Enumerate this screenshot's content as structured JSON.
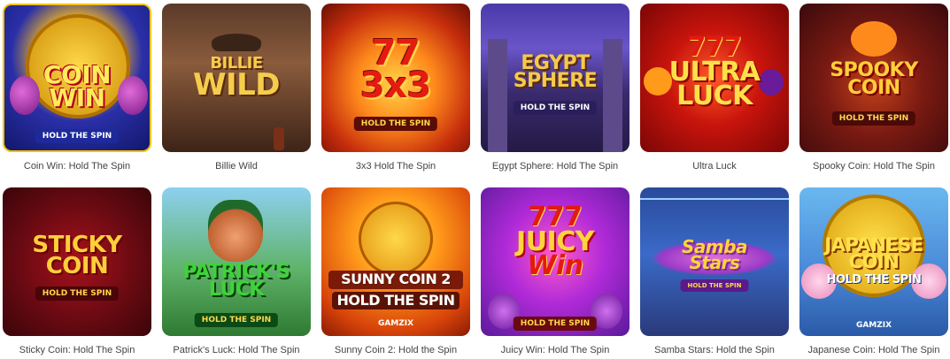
{
  "games": [
    {
      "title": "Coin Win: Hold The Spin",
      "logo_lines": [
        "COIN",
        "WIN"
      ],
      "badge": "HOLD THE SPIN",
      "selected": true
    },
    {
      "title": "Billie Wild",
      "logo_lines": [
        "BILLIE",
        "WILD"
      ]
    },
    {
      "title": "3x3 Hold The Spin",
      "logo_lines": [
        "77",
        "3x3"
      ],
      "badge": "HOLD THE SPIN"
    },
    {
      "title": "Egypt Sphere: Hold The Spin",
      "logo_lines": [
        "EGYPT",
        "SPHERE"
      ],
      "badge": "HOLD THE SPIN"
    },
    {
      "title": "Ultra Luck",
      "logo_lines": [
        "777",
        "ULTRA",
        "LUCK"
      ]
    },
    {
      "title": "Spooky Coin: Hold The Spin",
      "logo_lines": [
        "SPOOKY",
        "COIN"
      ],
      "badge": "HOLD THE SPIN"
    },
    {
      "title": "Sticky Coin: Hold The Spin",
      "logo_lines": [
        "STICKY",
        "COIN"
      ],
      "badge": "HOLD THE SPIN"
    },
    {
      "title": "Patrick's Luck: Hold The Spin",
      "logo_lines": [
        "PATRICK'S",
        "LUCK"
      ],
      "badge": "HOLD THE SPIN"
    },
    {
      "title": "Sunny Coin 2: Hold the Spin",
      "logo_lines": [
        "SUNNY COIN 2",
        "HOLD THE SPIN"
      ],
      "badge": "GAMZIX"
    },
    {
      "title": "Juicy Win: Hold The Spin",
      "logo_lines": [
        "777",
        "JUICY",
        "Win"
      ],
      "badge": "HOLD THE SPIN"
    },
    {
      "title": "Samba Stars: Hold the Spin",
      "logo_lines": [
        "Samba",
        "Stars"
      ],
      "badge": "HOLD THE SPIN"
    },
    {
      "title": "Japanese Coin: Hold The Spin",
      "logo_lines": [
        "JAPANESE",
        "COIN",
        "HOLD THE SPIN"
      ],
      "badge": "GAMZIX"
    }
  ]
}
